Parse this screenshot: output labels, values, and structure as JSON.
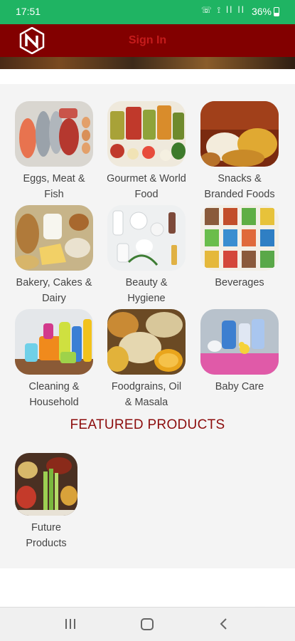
{
  "status_bar": {
    "time": "17:51",
    "icons": "☏ ⟟ ⅼⅼ ⅼⅼ",
    "battery": "36%"
  },
  "header": {
    "sign_in_label": "Sign In"
  },
  "categories": [
    {
      "label": "Eggs, Meat & Fish",
      "icon": "meat-fish-photo"
    },
    {
      "label": "Gourmet & World Food",
      "icon": "gourmet-jars-photo"
    },
    {
      "label": "Snacks & Branded Foods",
      "icon": "snacks-photo"
    },
    {
      "label": "Bakery, Cakes & Dairy",
      "icon": "bakery-dairy-photo"
    },
    {
      "label": "Beauty & Hygiene",
      "icon": "beauty-products-photo"
    },
    {
      "label": "Beverages",
      "icon": "beverages-photo"
    },
    {
      "label": "Cleaning & Household",
      "icon": "cleaning-supplies-photo"
    },
    {
      "label": "Foodgrains, Oil & Masala",
      "icon": "grains-oil-photo"
    },
    {
      "label": "Baby Care",
      "icon": "baby-care-photo"
    }
  ],
  "featured": {
    "title": "FEATURED PRODUCTS",
    "items": [
      {
        "label": "Future Products",
        "icon": "future-products-photo"
      }
    ]
  },
  "colors": {
    "status_bar": "#1fb463",
    "header": "#820000",
    "accent": "#8c0c0c",
    "fab": "#a40000"
  }
}
